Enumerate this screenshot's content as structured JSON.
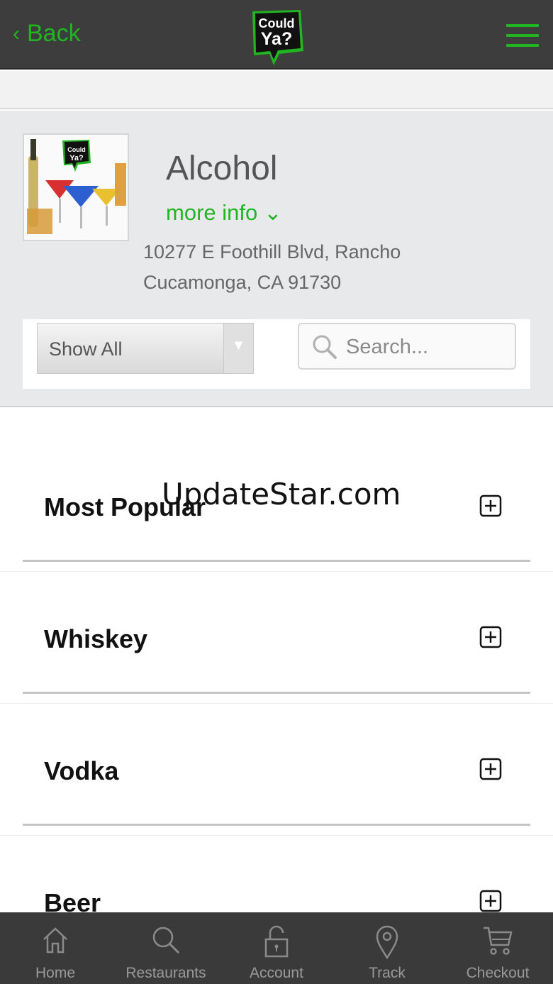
{
  "header": {
    "back_label": "Back",
    "logo_text_line1": "Could",
    "logo_text_line2": "Ya?",
    "accent_color": "#21b521"
  },
  "restaurant": {
    "name": "Alcohol",
    "more_info_label": "more info",
    "address": "10277 E Foothill Blvd, Rancho Cucamonga, CA 91730"
  },
  "filter": {
    "selected": "Show All",
    "search_placeholder": "Search..."
  },
  "categories": [
    {
      "name": "Most Popular",
      "icon": "plus-square-icon"
    },
    {
      "name": "Whiskey",
      "icon": "plus-square-icon"
    },
    {
      "name": "Vodka",
      "icon": "plus-square-icon"
    },
    {
      "name": "Beer",
      "icon": "plus-square-icon"
    }
  ],
  "watermark": "UpdateStar.com",
  "tabs": [
    {
      "label": "Home",
      "icon": "home-icon"
    },
    {
      "label": "Restaurants",
      "icon": "search-icon"
    },
    {
      "label": "Account",
      "icon": "lock-icon"
    },
    {
      "label": "Track",
      "icon": "location-pin-icon"
    },
    {
      "label": "Checkout",
      "icon": "cart-icon"
    }
  ]
}
